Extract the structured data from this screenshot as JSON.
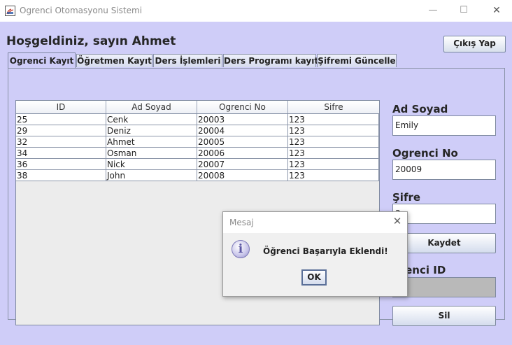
{
  "window": {
    "title": "Ogrenci Otomasyonu Sistemi",
    "min": "—",
    "max": "☐",
    "close": "✕"
  },
  "header": {
    "welcome": "Hoşgeldiniz, sayın Ahmet",
    "logout_label": "Çıkış Yap"
  },
  "tabs": [
    {
      "label": "Ogrenci Kayıt",
      "active": true
    },
    {
      "label": "Öğretmen Kayıt",
      "active": false
    },
    {
      "label": "Ders İşlemleri",
      "active": false
    },
    {
      "label": "Ders Programı kayıt",
      "active": false
    },
    {
      "label": "Şifremi Güncelle",
      "active": false
    }
  ],
  "table": {
    "columns": [
      "ID",
      "Ad Soyad",
      "Ogrenci No",
      "Sifre"
    ],
    "rows": [
      [
        "25",
        "Cenk",
        "20003",
        "123"
      ],
      [
        "29",
        "Deniz",
        "20004",
        "123"
      ],
      [
        "32",
        "Ahmet",
        "20005",
        "123"
      ],
      [
        "34",
        "Osman",
        "20006",
        "123"
      ],
      [
        "36",
        "Nick",
        "20007",
        "123"
      ],
      [
        "38",
        "John",
        "20008",
        "123"
      ]
    ]
  },
  "form": {
    "ad_soyad_label": "Ad Soyad",
    "ad_soyad_value": "Emily",
    "ogrenci_no_label": "Ogrenci No",
    "ogrenci_no_value": "20009",
    "sifre_label": "Şifre",
    "sifre_value": "3",
    "save_label": "Kaydet",
    "ogrenci_id_label": "grenci ID",
    "ogrenci_id_value": "",
    "delete_label": "Sil"
  },
  "dialog": {
    "title": "Mesaj",
    "close": "✕",
    "icon": "info-icon",
    "icon_glyph": "i",
    "message": "Öğrenci Başarıyla Eklendi!",
    "ok_label": "OK"
  },
  "colors": {
    "background": "#cfcdf8",
    "disabled_field": "#b9b9b9"
  }
}
